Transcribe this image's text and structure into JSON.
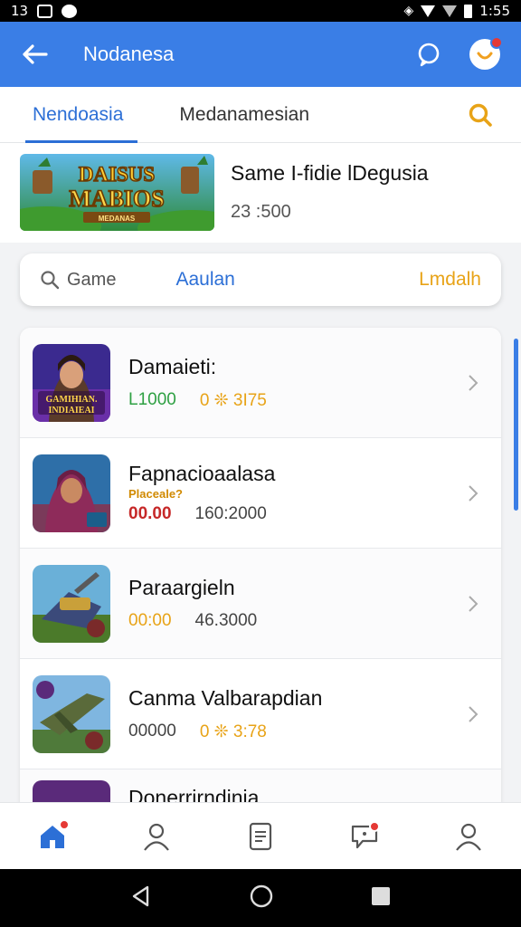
{
  "status_bar": {
    "time": "13",
    "clock": "1:55"
  },
  "app_bar": {
    "title": "Nodanesa"
  },
  "tabs": [
    {
      "label": "Nendoasia",
      "active": true
    },
    {
      "label": "Medanamesian",
      "active": false
    }
  ],
  "featured": {
    "title": "Same I-fidie lDegusia",
    "subtitle": "23 :500",
    "thumb_lettering": [
      "DAISUS",
      "MABIOS",
      "MEDANAS"
    ]
  },
  "filter": {
    "search_label": "Game",
    "middle_label": "Aaulan",
    "right_label": "Lmdalh"
  },
  "games": [
    {
      "title": "Damaieti:",
      "tag": "",
      "value1": "L1000",
      "value1_color": "#2ea043",
      "value2": "0 ❊ 3I75",
      "value2_color": "#e8a317",
      "thumb_lettering": "GAMIHIAN. INDIAIEAI"
    },
    {
      "title": "Fapnacioaalasa",
      "tag": "Placeale?",
      "value1": "00.00",
      "value1_color": "#c62828",
      "value2": "160:2000",
      "value2_color": "#444444",
      "thumb_lettering": ""
    },
    {
      "title": "Paraargieln",
      "tag": "",
      "value1": "00:00",
      "value1_color": "#e8a317",
      "value2": "46.3000",
      "value2_color": "#444444",
      "thumb_lettering": ""
    },
    {
      "title": "Canma Valbarapdian",
      "tag": "",
      "value1": "00000",
      "value1_color": "#444444",
      "value2": "0 ❊ 3:78",
      "value2_color": "#e8a317",
      "thumb_lettering": ""
    },
    {
      "title": "Donerrirndinia",
      "tag": "",
      "value1": "",
      "value1_color": "#444444",
      "value2": "",
      "value2_color": "#444444",
      "thumb_lettering": ""
    }
  ],
  "colors": {
    "primary": "#3a7ee6",
    "accent_orange": "#e8a317",
    "green": "#2ea043",
    "red": "#c62828"
  },
  "bottom_nav": [
    "home-icon",
    "profile-icon",
    "document-icon",
    "chat-icon",
    "account-icon"
  ]
}
